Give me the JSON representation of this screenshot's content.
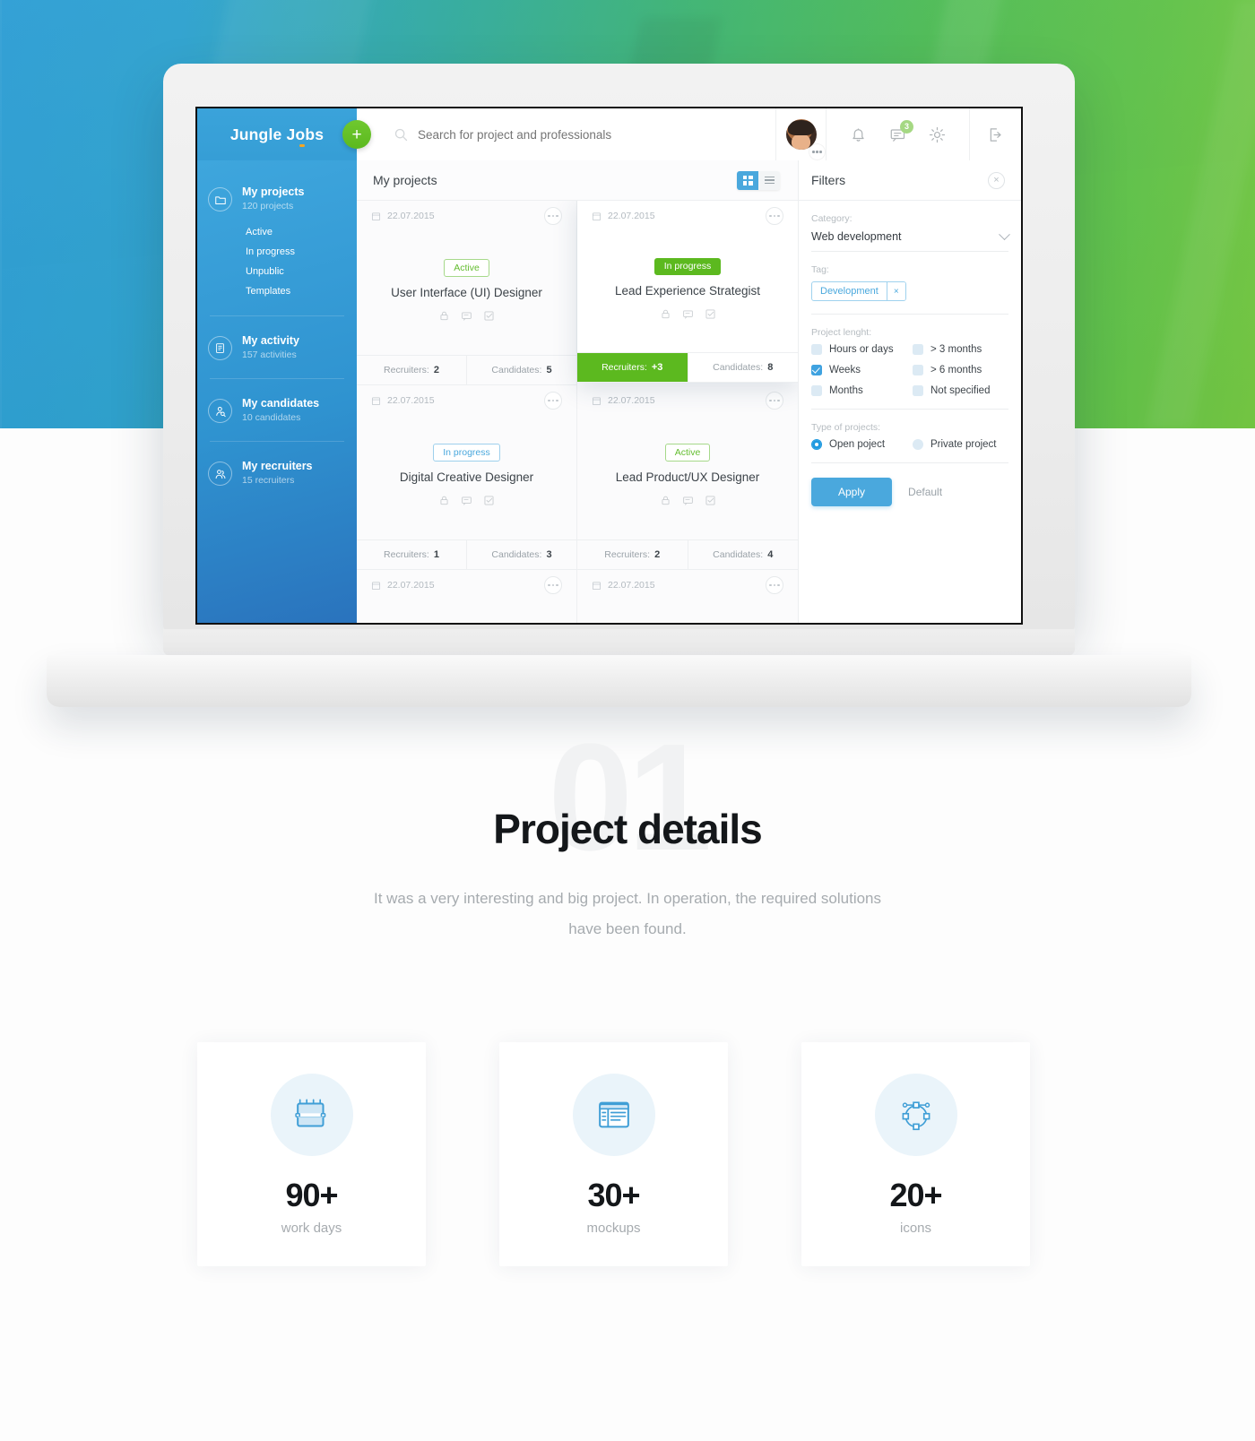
{
  "app": {
    "brand": "Jungle Jobs",
    "brand_accent_color": "#f5a623",
    "add_button_label": "+",
    "search_placeholder": "Search for project and professionals",
    "message_badge": "3"
  },
  "sidebar": {
    "groups": [
      {
        "title": "My projects",
        "subtitle": "120 projects",
        "icon": "folder-icon",
        "sublinks": [
          "Active",
          "In progress",
          "Unpublic",
          "Templates"
        ]
      },
      {
        "title": "My activity",
        "subtitle": "157 activities",
        "icon": "document-icon",
        "sublinks": []
      },
      {
        "title": "My candidates",
        "subtitle": "10 candidates",
        "icon": "user-search-icon",
        "sublinks": []
      },
      {
        "title": "My recruiters",
        "subtitle": "15 recruiters",
        "icon": "users-icon",
        "sublinks": []
      }
    ]
  },
  "projects": {
    "heading": "My projects",
    "view_grid": "grid-view",
    "view_list": "list-view",
    "recruiters_label": "Recruiters:",
    "candidates_label": "Candidates:",
    "cards": [
      {
        "date": "22.07.2015",
        "status": "Active",
        "status_style": "active",
        "title": "User Interface (UI) Designer",
        "recruiters": "2",
        "candidates": "5",
        "highlight": false
      },
      {
        "date": "22.07.2015",
        "status": "In progress",
        "status_style": "inprogress-solid",
        "title": "Lead Experience Strategist",
        "recruiters": "+3",
        "candidates": "8",
        "highlight": true
      },
      {
        "date": "22.07.2015",
        "status": "In progress",
        "status_style": "inprogress-outline",
        "title": "Digital Creative Designer",
        "recruiters": "1",
        "candidates": "3",
        "highlight": false
      },
      {
        "date": "22.07.2015",
        "status": "Active",
        "status_style": "active",
        "title": "Lead Product/UX Designer",
        "recruiters": "2",
        "candidates": "4",
        "highlight": false
      }
    ],
    "partial_row": [
      {
        "date": "22.07.2015"
      },
      {
        "date": "22.07.2015"
      }
    ]
  },
  "filters": {
    "title": "Filters",
    "close": "×",
    "category_label": "Category:",
    "category_value": "Web development",
    "tag_label": "Tag:",
    "tag_value": "Development",
    "tag_remove": "×",
    "length_label": "Project lenght:",
    "length_options": [
      {
        "label": "Hours or days",
        "checked": false
      },
      {
        "label": "> 3 months",
        "checked": false
      },
      {
        "label": "Weeks",
        "checked": true
      },
      {
        "label": "> 6 months",
        "checked": false
      },
      {
        "label": "Months",
        "checked": false
      },
      {
        "label": "Not specified",
        "checked": false
      }
    ],
    "type_label": "Type of projects:",
    "type_options": [
      {
        "label": "Open poject",
        "selected": true
      },
      {
        "label": "Private project",
        "selected": false
      }
    ],
    "apply_label": "Apply",
    "default_label": "Default"
  },
  "details": {
    "watermark": "01",
    "title": "Project details",
    "body": "It was a very interesting and big project. In operation, the required solutions have been found."
  },
  "stats": [
    {
      "number": "90+",
      "label": "work days",
      "icon": "calendar-icon"
    },
    {
      "number": "30+",
      "label": "mockups",
      "icon": "browser-layout-icon"
    },
    {
      "number": "20+",
      "label": "icons",
      "icon": "vector-path-icon"
    }
  ]
}
